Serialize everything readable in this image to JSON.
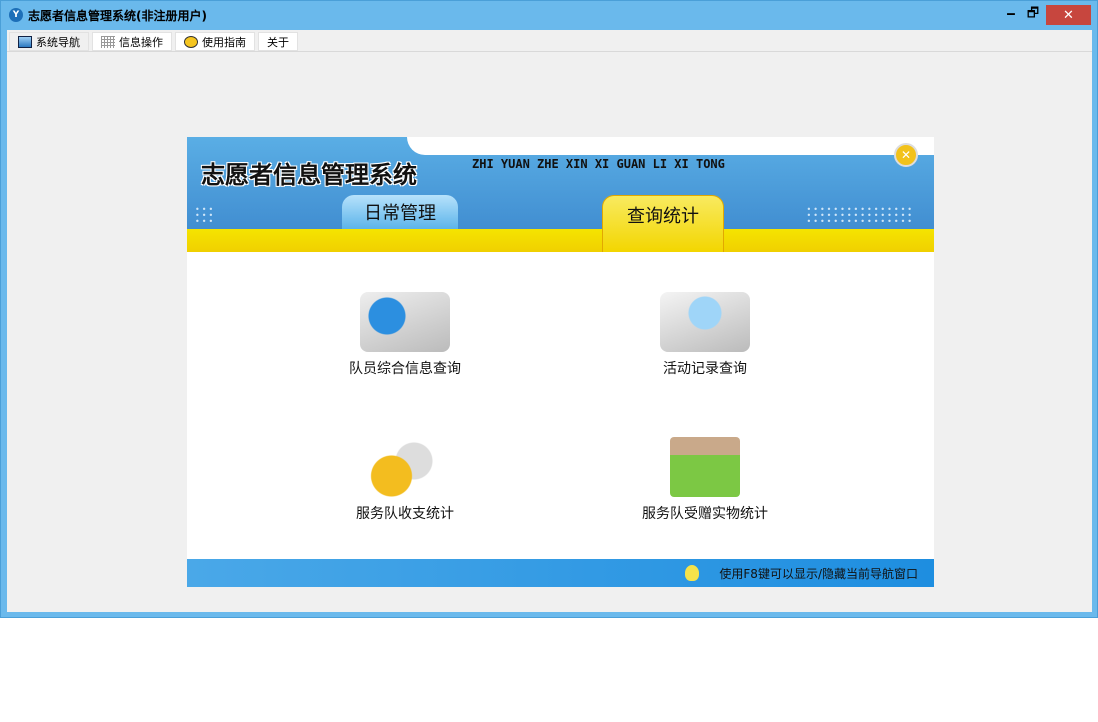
{
  "window": {
    "title": "志愿者信息管理系统(非注册用户)",
    "minimize": "🗕",
    "restore": "🗗",
    "close": "✕"
  },
  "menu_tabs": [
    {
      "label": "系统导航"
    },
    {
      "label": "信息操作"
    },
    {
      "label": "使用指南"
    },
    {
      "label": "关于"
    }
  ],
  "panel": {
    "title": "志愿者信息管理系统",
    "pinyin": "ZHI YUAN ZHE XIN XI GUAN LI XI TONG",
    "close": "✕",
    "tabs": [
      {
        "label": "日常管理"
      },
      {
        "label": "查询统计"
      }
    ],
    "items": [
      {
        "label": "队员综合信息查询"
      },
      {
        "label": "活动记录查询"
      },
      {
        "label": "服务队收支统计"
      },
      {
        "label": "服务队受赠实物统计"
      }
    ],
    "footer_hint": "使用F8键可以显示/隐藏当前导航窗口"
  }
}
